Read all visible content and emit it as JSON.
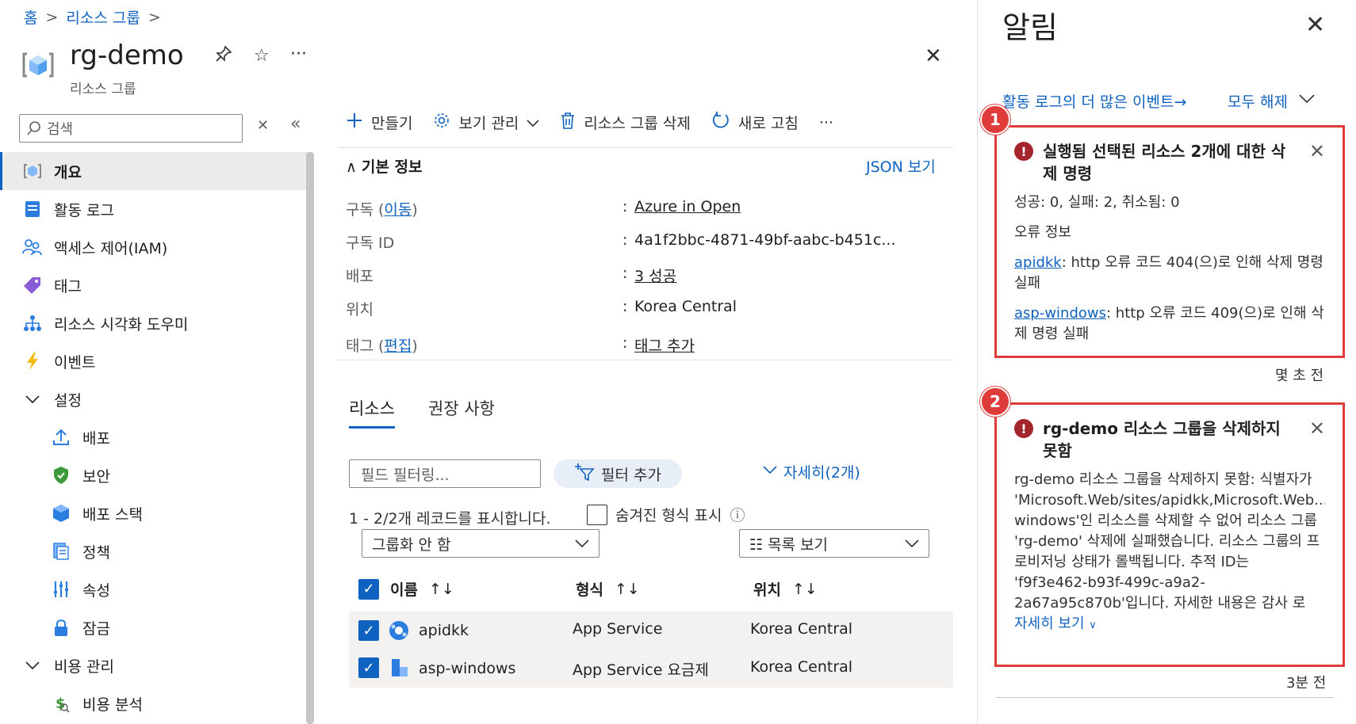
{
  "breadcrumb": {
    "home": "홈",
    "resource_groups": "리소스 그룹",
    "sep": ">"
  },
  "header": {
    "title": "rg-demo",
    "subtitle": "리소스 그룹",
    "pin": "📌",
    "star": "☆",
    "more": "···",
    "close": "✕"
  },
  "search": {
    "placeholder": "검색",
    "clear": "✕",
    "collapse": "«"
  },
  "nav": {
    "items": [
      {
        "label": "개요"
      },
      {
        "label": "활동 로그"
      },
      {
        "label": "액세스 제어(IAM)"
      },
      {
        "label": "태그"
      },
      {
        "label": "리소스 시각화 도우미"
      },
      {
        "label": "이벤트"
      },
      {
        "label": "설정"
      },
      {
        "label": "배포"
      },
      {
        "label": "보안"
      },
      {
        "label": "배포 스택"
      },
      {
        "label": "정책"
      },
      {
        "label": "속성"
      },
      {
        "label": "잠금"
      },
      {
        "label": "비용 관리"
      },
      {
        "label": "비용 분석"
      }
    ]
  },
  "toolbar": {
    "create": "만들기",
    "manage_view": "보기 관리",
    "delete_rg": "리소스 그룹 삭제",
    "refresh": "새로 고침",
    "more": "···"
  },
  "essentials": {
    "title": "기본 정보",
    "json_view": "JSON 보기",
    "subscription_label": "구독 (",
    "subscription_move": "이동",
    "subscription_label_end": ")",
    "subscription_value": "Azure in Open",
    "subscription_id_label": "구독 ID",
    "subscription_id_value": "4a1f2bbc-4871-49bf-aabc-b451c...",
    "deployments_label": "배포",
    "deployments_value": "3 성공",
    "location_label": "위치",
    "location_value": "Korea Central",
    "tags_label": "태그 (",
    "tags_edit": "편집",
    "tags_label_end": ")",
    "tags_value": "태그 추가",
    "colon": ":"
  },
  "tabs": {
    "resources": "리소스",
    "recommendations": "권장 사항"
  },
  "filters": {
    "placeholder": "필드 필터링...",
    "add_filter": "필터 추가",
    "details": "자세히(2개)"
  },
  "records": {
    "count_text": "1 - 2/2개 레코드를 표시합니다.",
    "hidden_types": "숨겨진 형식 표시",
    "info": "ⓘ"
  },
  "dropdowns": {
    "group_by": "그룹화 안 함",
    "view_mode": "☷ 목록 보기"
  },
  "table": {
    "headers": {
      "name": "이름",
      "type": "형식",
      "location": "위치",
      "sort": "↑↓"
    },
    "rows": [
      {
        "name": "apidkk",
        "type": "App Service",
        "location": "Korea Central"
      },
      {
        "name": "asp-windows",
        "type": "App Service 요금제",
        "location": "Korea Central"
      }
    ]
  },
  "notifications": {
    "title": "알림",
    "close": "✕",
    "more_events": "활동 로그의 더 많은 이벤트→",
    "dismiss_all": "모두 해제",
    "items": [
      {
        "badge": "1",
        "title": "실행됨 선택된 리소스 2개에 대한 삭제 명령",
        "summary": "성공: 0, 실패: 2, 취소됨: 0",
        "error_heading": "오류 정보",
        "err1_link": "apidkk",
        "err1_text": ": http 오류 코드 404(으)로 인해 삭제 명령 실패",
        "err2_link": "asp-windows",
        "err2_text": ": http 오류 코드 409(으)로 인해 삭제 명령 실패",
        "time": "몇 초 전"
      },
      {
        "badge": "2",
        "title": "rg-demo 리소스 그룹을 삭제하지 못함",
        "body": "rg-demo 리소스 그룹을 삭제하지 못함: 식별자가 'Microsoft.Web/sites/apidkk,Microsoft.Web... windows'인 리소스를 삭제할 수 없어 리소스 그룹 'rg-demo' 삭제에 실패했습니다. 리소스 그룹의 프로비저닝 상태가 롤백됩니다. 추적 ID는 'f9f3e462-b93f-499c-a9a2-2a67a95c870b'입니다. 자세한 내용은 감사 로",
        "more": "자세히 보기",
        "time": "3분 전"
      }
    ]
  },
  "colors": {
    "accent": "#0f62c0",
    "error": "#a4262c",
    "highlight": "#e03b3b"
  }
}
